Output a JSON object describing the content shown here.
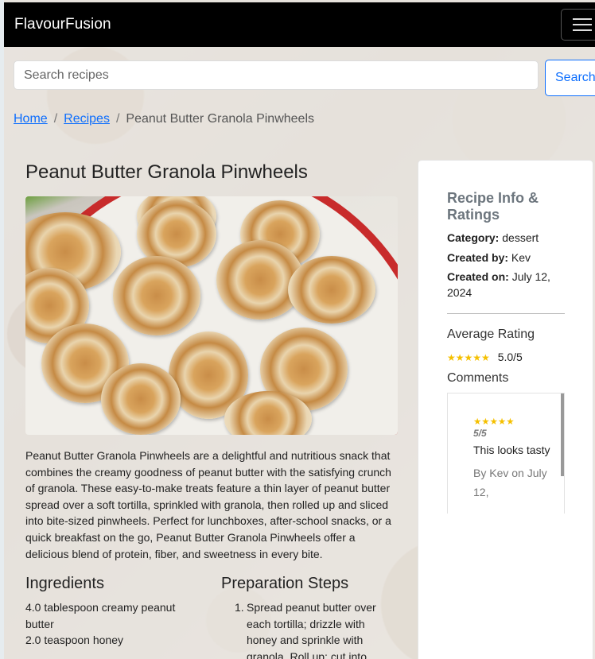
{
  "navbar": {
    "brand": "FlavourFusion",
    "menu_icon": "hamburger-menu-icon"
  },
  "search": {
    "placeholder": "Search recipes",
    "value": "",
    "button_label": "Search"
  },
  "breadcrumb": {
    "items": [
      "Home",
      "Recipes",
      "Peanut Butter Granola Pinwheels"
    ],
    "separator": "/"
  },
  "recipe": {
    "title": "Peanut Butter Granola Pinwheels",
    "description": "Peanut Butter Granola Pinwheels are a delightful and nutritious snack that combines the creamy goodness of peanut butter with the satisfying crunch of granola. These easy-to-make treats feature a thin layer of peanut butter spread over a soft tortilla, sprinkled with granola, then rolled up and sliced into bite-sized pinwheels. Perfect for lunchboxes, after-school snacks, or a quick breakfast on the go, Peanut Butter Granola Pinwheels offer a delicious blend of protein, fiber, and sweetness in every bite.",
    "ingredients_heading": "Ingredients",
    "ingredients": [
      "4.0 tablespoon creamy peanut butter",
      "2.0 teaspoon honey"
    ],
    "steps_heading": "Preparation Steps",
    "steps": [
      {
        "number": "1.",
        "text": "Spread peanut butter over each tortilla; drizzle with honey and sprinkle with granola. Roll up; cut into"
      }
    ]
  },
  "info": {
    "title": "Recipe Info & Ratings",
    "category_label": "Category:",
    "category": "dessert",
    "created_by_label": "Created by:",
    "created_by": "Kev",
    "created_on_label": "Created on:",
    "created_on": "July 12, 2024",
    "average_rating_label": "Average Rating",
    "rating_stars": "★★★★★",
    "rating_value": "5.0/5",
    "comments_label": "Comments",
    "comments": [
      {
        "stars": "★★★★★",
        "score": "5/5",
        "text": "This looks tasty",
        "meta": "By Kev on July 12,"
      }
    ]
  },
  "colors": {
    "accent": "#0d6efd",
    "navbar": "#000000",
    "star": "#f5c000",
    "muted": "#6c757d"
  }
}
